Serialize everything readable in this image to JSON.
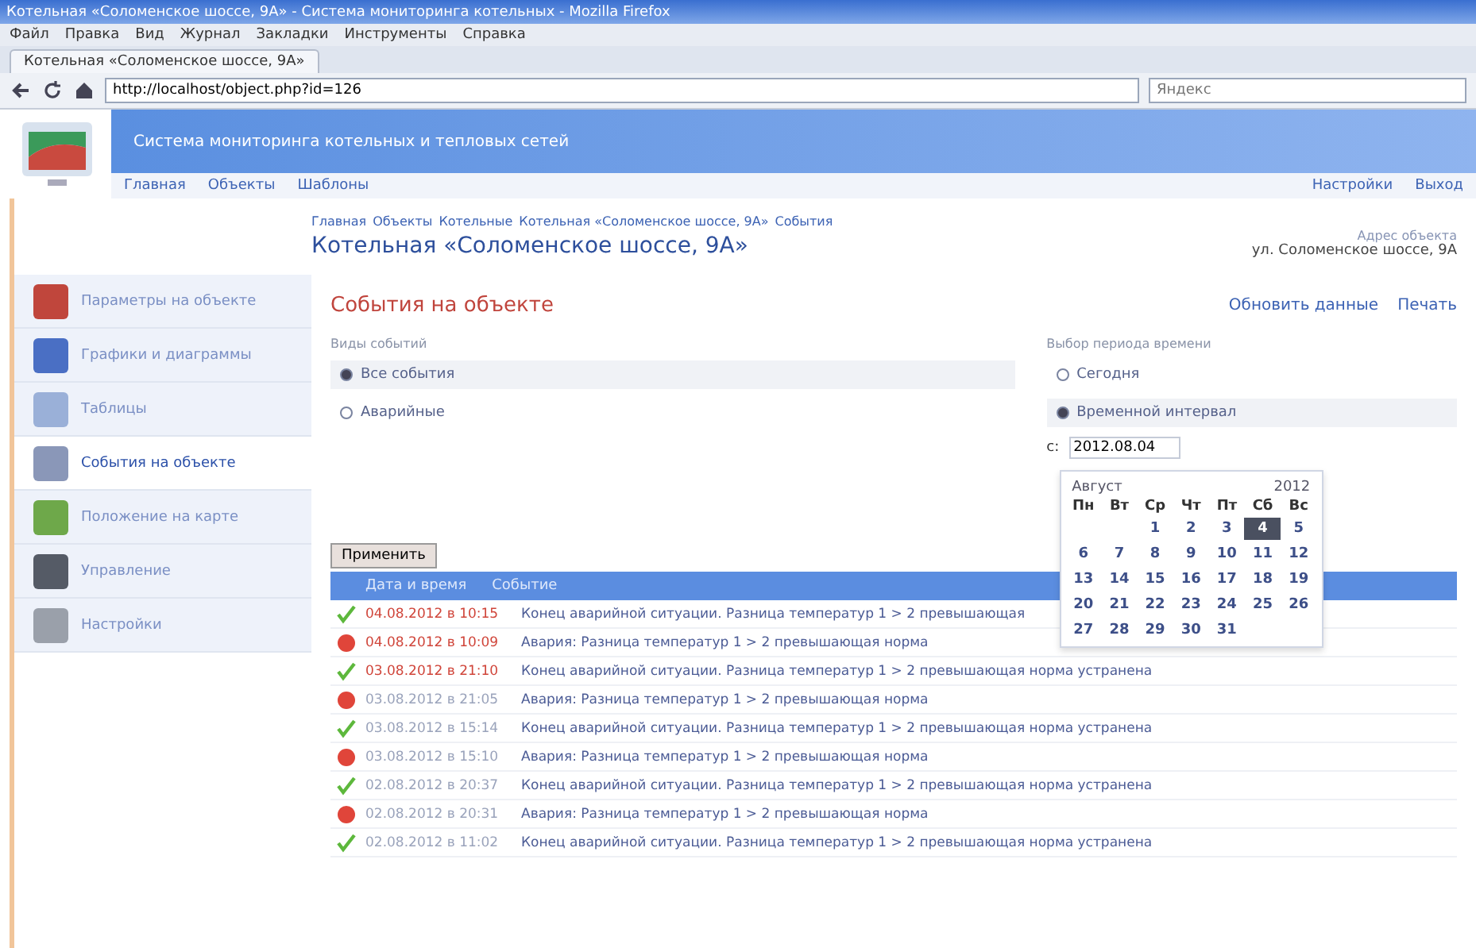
{
  "window": {
    "title": "Котельная «Соломенское шоссе, 9А» - Система мониторинга котельных - Mozilla Firefox"
  },
  "menu": [
    "Файл",
    "Правка",
    "Вид",
    "Журнал",
    "Закладки",
    "Инструменты",
    "Справка"
  ],
  "tab": {
    "label": "Котельная «Соломенское шоссе, 9А»"
  },
  "address": {
    "value": "http://localhost/object.php?id=126"
  },
  "search": {
    "placeholder": "Яндекс"
  },
  "site": {
    "title": "Система мониторинга котельных и тепловых сетей",
    "nav": [
      "Главная",
      "Объекты",
      "Шаблоны"
    ],
    "user_links": [
      "Настройки",
      "Выход"
    ]
  },
  "breadcrumbs": [
    "Главная",
    "Объекты",
    "Котельные",
    "Котельная «Соломенское шоссе, 9А»",
    "События"
  ],
  "page": {
    "title": "Котельная «Соломенское шоссе, 9А»",
    "caption": "Адрес объекта",
    "address": "ул. Соломенское шоссе, 9А"
  },
  "sidebar": [
    {
      "label": "Параметры на объекте",
      "selected": false
    },
    {
      "label": "Графики и диаграммы",
      "selected": false
    },
    {
      "label": "Таблицы",
      "selected": false
    },
    {
      "label": "События на объекте",
      "selected": true
    },
    {
      "label": "Положение на карте",
      "selected": false
    },
    {
      "label": "Управление",
      "selected": false
    },
    {
      "label": "Настройки",
      "selected": false
    }
  ],
  "section": {
    "title": "События на объекте",
    "actions": [
      "Обновить данные",
      "Печать"
    ]
  },
  "event_types": {
    "label": "Виды событий",
    "options": [
      {
        "label": "Все события",
        "selected": true
      },
      {
        "label": "Аварийные",
        "selected": false
      }
    ]
  },
  "period": {
    "label": "Выбор периода времени",
    "options": [
      {
        "label": "Сегодня",
        "selected": false
      },
      {
        "label": "Временной интервал",
        "selected": true
      }
    ],
    "from_label": "с:",
    "from_value": "2012.08.04"
  },
  "calendar": {
    "month": "Август",
    "year": "2012",
    "weekdays": [
      "Пн",
      "Вт",
      "Ср",
      "Чт",
      "Пт",
      "Сб",
      "Вс"
    ],
    "days": [
      {
        "label": "1",
        "selected": false
      },
      {
        "label": "2",
        "selected": false
      },
      {
        "label": "3",
        "selected": false
      },
      {
        "label": "4",
        "selected": true
      },
      {
        "label": "5",
        "selected": false
      },
      {
        "label": "6",
        "selected": false
      },
      {
        "label": "7",
        "selected": false
      },
      {
        "label": "8",
        "selected": false
      },
      {
        "label": "9",
        "selected": false
      },
      {
        "label": "10",
        "selected": false
      },
      {
        "label": "11",
        "selected": false
      },
      {
        "label": "12",
        "selected": false
      },
      {
        "label": "13",
        "selected": false
      },
      {
        "label": "14",
        "selected": false
      },
      {
        "label": "15",
        "selected": false
      },
      {
        "label": "16",
        "selected": false
      },
      {
        "label": "17",
        "selected": false
      },
      {
        "label": "18",
        "selected": false
      },
      {
        "label": "19",
        "selected": false
      },
      {
        "label": "20",
        "selected": false
      },
      {
        "label": "21",
        "selected": false
      },
      {
        "label": "22",
        "selected": false
      },
      {
        "label": "23",
        "selected": false
      },
      {
        "label": "24",
        "selected": false
      },
      {
        "label": "25",
        "selected": false
      },
      {
        "label": "26",
        "selected": false
      },
      {
        "label": "27",
        "selected": false
      },
      {
        "label": "28",
        "selected": false
      },
      {
        "label": "29",
        "selected": false
      },
      {
        "label": "30",
        "selected": false
      },
      {
        "label": "31",
        "selected": false
      }
    ]
  },
  "apply_button": "Применить",
  "table": {
    "columns": [
      "Дата и время",
      "Событие"
    ],
    "rows": [
      {
        "kind": "resolved",
        "active": true,
        "time": "04.08.2012 в 10:15",
        "text": "Конец аварийной ситуации. Разница температур 1 > 2 превышающая"
      },
      {
        "kind": "alarm",
        "active": true,
        "time": "04.08.2012 в 10:09",
        "text": "Авария: Разница температур 1 > 2 превышающая норма"
      },
      {
        "kind": "resolved",
        "active": true,
        "time": "03.08.2012 в 21:10",
        "text": "Конец аварийной ситуации. Разница температур 1 > 2 превышающая норма устранена"
      },
      {
        "kind": "alarm",
        "active": false,
        "time": "03.08.2012 в 21:05",
        "text": "Авария: Разница температур 1 > 2 превышающая норма"
      },
      {
        "kind": "resolved",
        "active": false,
        "time": "03.08.2012 в 15:14",
        "text": "Конец аварийной ситуации. Разница температур 1 > 2 превышающая норма устранена"
      },
      {
        "kind": "alarm",
        "active": false,
        "time": "03.08.2012 в 15:10",
        "text": "Авария: Разница температур 1 > 2 превышающая норма"
      },
      {
        "kind": "resolved",
        "active": false,
        "time": "02.08.2012 в 20:37",
        "text": "Конец аварийной ситуации. Разница температур 1 > 2 превышающая норма устранена"
      },
      {
        "kind": "alarm",
        "active": false,
        "time": "02.08.2012 в 20:31",
        "text": "Авария: Разница температур 1 > 2 превышающая норма"
      },
      {
        "kind": "resolved",
        "active": false,
        "time": "02.08.2012 в 11:02",
        "text": "Конец аварийной ситуации. Разница температур 1 > 2 превышающая норма устранена"
      }
    ]
  }
}
